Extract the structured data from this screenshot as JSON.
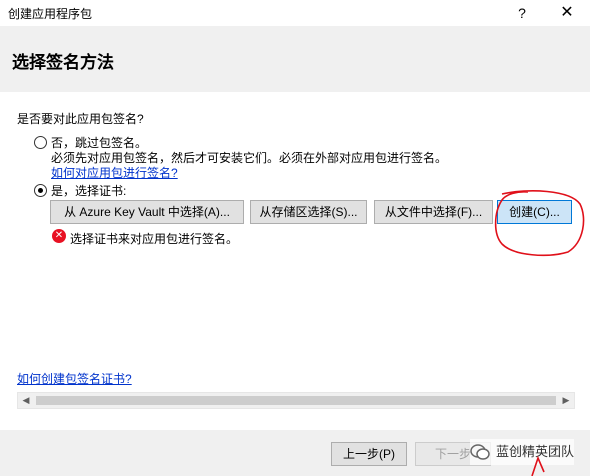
{
  "window": {
    "title": "创建应用程序包",
    "help_label": "?",
    "close_label": "✕"
  },
  "page": {
    "title": "选择签名方法",
    "prompt": "是否要对此应用包签名?"
  },
  "options": {
    "skip_label": "否，跳过包签名。",
    "skip_desc": "必须先对应用包签名，然后才可安装它们。必须在外部对应用包进行签名。",
    "skip_link": "如何对应用包进行签名?",
    "cert_label": "是，选择证书:",
    "selected": "cert"
  },
  "cert_buttons": {
    "azure": "从 Azure Key Vault 中选择(A)...",
    "store": "从存储区选择(S)...",
    "file": "从文件中选择(F)...",
    "create": "创建(C)..."
  },
  "error": {
    "icon": "error-icon",
    "text": "选择证书来对应用包进行签名。"
  },
  "help_link": "如何创建包签名证书?",
  "nav": {
    "back": "上一步(P)",
    "next": "下一步"
  },
  "watermark": {
    "text": "蓝创精英团队"
  },
  "colors": {
    "link": "#0033cc",
    "error": "#e81123",
    "annotation": "#e0101a",
    "highlight_button": "#cce4f7"
  }
}
